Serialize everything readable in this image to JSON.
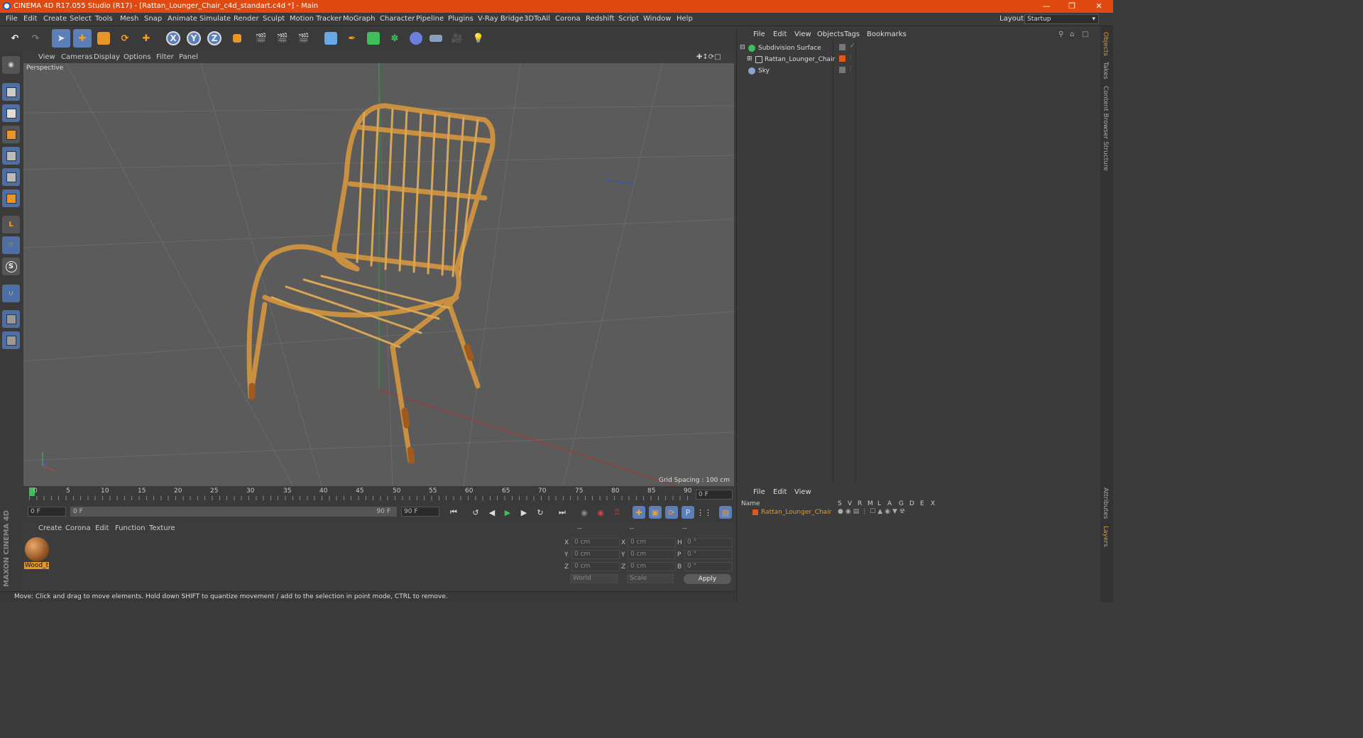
{
  "window": {
    "title": "CINEMA 4D R17.055 Studio (R17) - [Rattan_Lounger_Chair_c4d_standart.c4d *] - Main"
  },
  "menubar": [
    "File",
    "Edit",
    "Create",
    "Select",
    "Tools",
    "Mesh",
    "Snap",
    "Animate",
    "Simulate",
    "Render",
    "Sculpt",
    "Motion Tracker",
    "MoGraph",
    "Character",
    "Pipeline",
    "Plugins",
    "V-Ray Bridge",
    "3DToAll",
    "Corona",
    "Redshift",
    "Script",
    "Window",
    "Help"
  ],
  "layout": {
    "label": "Layout:",
    "value": "Startup"
  },
  "viewport": {
    "menu": [
      "View",
      "Cameras",
      "Display",
      "Options",
      "Filter",
      "Panel"
    ],
    "label": "Perspective",
    "grid_spacing": "Grid Spacing : 100 cm"
  },
  "timeline": {
    "ticks": [
      "0",
      "5",
      "10",
      "15",
      "20",
      "25",
      "30",
      "35",
      "40",
      "45",
      "50",
      "55",
      "60",
      "65",
      "70",
      "75",
      "80",
      "85",
      "90"
    ],
    "frame_field": "0 F"
  },
  "playbar": {
    "start": "0 F",
    "range_start": "0 F",
    "range_end": "90 F",
    "end": "90 F"
  },
  "material_panel": {
    "menu": [
      "Create",
      "Corona",
      "Edit",
      "Function",
      "Texture"
    ],
    "material_name": "Wood_t"
  },
  "coords": {
    "header": [
      "--",
      "--",
      "--"
    ],
    "rows": [
      {
        "l1": "X",
        "v1": "0 cm",
        "l2": "X",
        "v2": "0 cm",
        "l3": "H",
        "v3": "0 °"
      },
      {
        "l1": "Y",
        "v1": "0 cm",
        "l2": "Y",
        "v2": "0 cm",
        "l3": "P",
        "v3": "0 °"
      },
      {
        "l1": "Z",
        "v1": "0 cm",
        "l2": "Z",
        "v2": "0 cm",
        "l3": "B",
        "v3": "0 °"
      }
    ],
    "world": "World",
    "scale": "Scale",
    "apply": "Apply"
  },
  "status": "Move: Click and drag to move elements. Hold down SHIFT to quantize movement / add to the selection in point mode, CTRL to remove.",
  "objects": {
    "menu": [
      "File",
      "Edit",
      "View",
      "Objects",
      "Tags",
      "Bookmarks"
    ],
    "items": [
      {
        "name": "Subdivision Surface",
        "color": "#3fbf5a"
      },
      {
        "name": "Rattan_Lounger_Chair",
        "color": "#cccccc"
      },
      {
        "name": "Sky",
        "color": "#8aa6d0"
      }
    ]
  },
  "attributes": {
    "menu": [
      "File",
      "Edit",
      "View"
    ],
    "headers": [
      "Name",
      "S",
      "V",
      "R",
      "M",
      "L",
      "A",
      "G",
      "D",
      "E",
      "X"
    ],
    "row": "Rattan_Lounger_Chair"
  },
  "side_tabs": [
    "Objects",
    "Takes",
    "Content Browser",
    "Structure",
    "Attributes",
    "Layers"
  ],
  "brand": "MAXON CINEMA 4D"
}
